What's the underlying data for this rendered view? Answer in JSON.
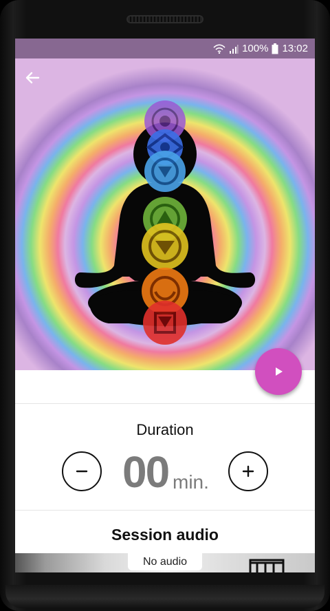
{
  "status_bar": {
    "battery": "100%",
    "time": "13:02",
    "icons": [
      "wifi-icon",
      "signal-icon",
      "battery-icon"
    ]
  },
  "hero": {
    "background_color": "#dcb5e3",
    "chakra_colors": [
      "#9b59d6",
      "#3a6fe6",
      "#4aa3e8",
      "#6fb33a",
      "#e0c21f",
      "#ef7a13",
      "#e0302b"
    ]
  },
  "accent_color": "#d14fbf",
  "duration": {
    "title": "Duration",
    "value": "00",
    "unit": "min."
  },
  "session_audio": {
    "title": "Session audio",
    "selected": "No audio"
  }
}
